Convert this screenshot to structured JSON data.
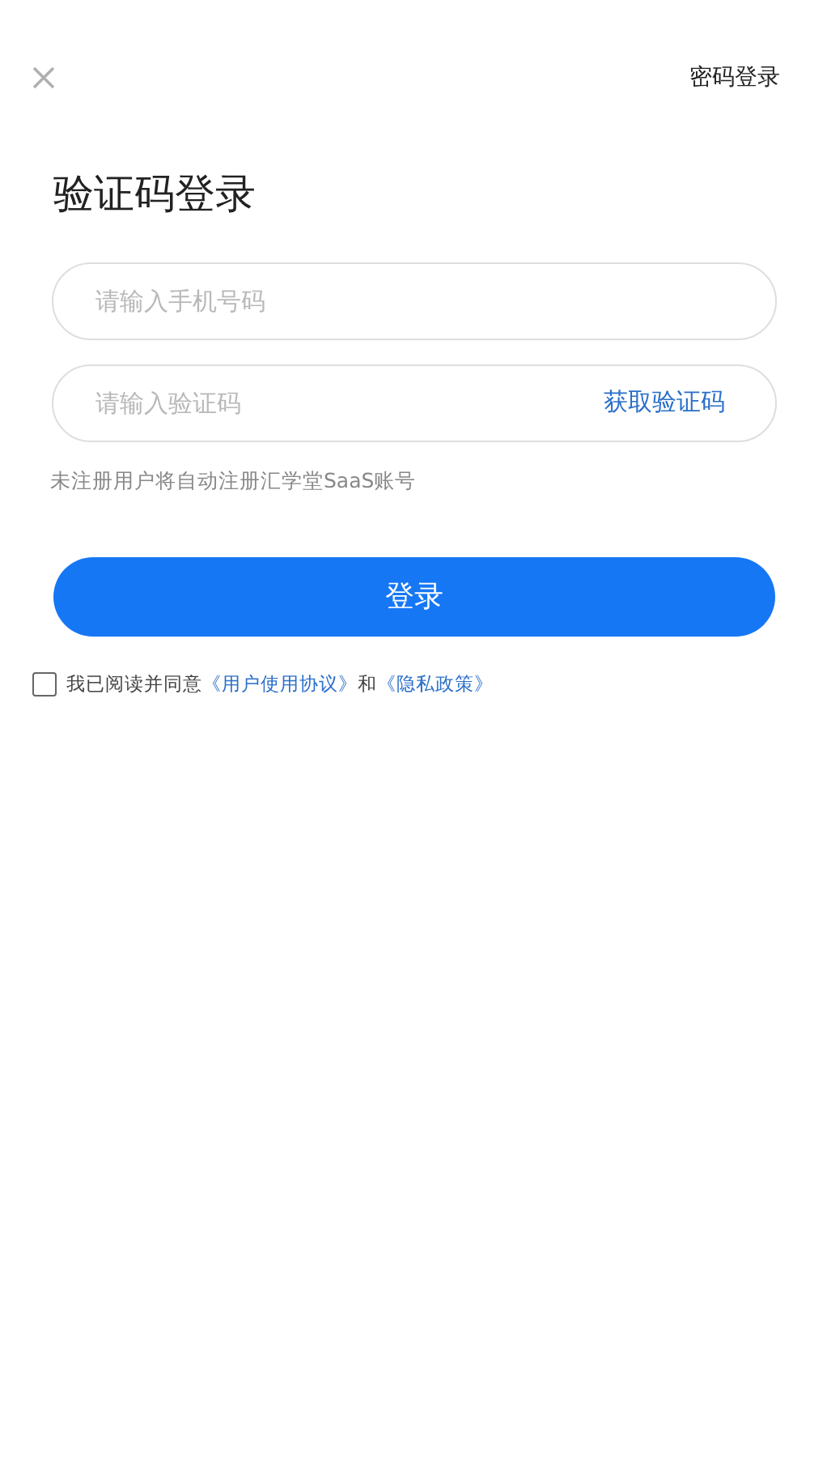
{
  "header": {
    "switch_link": "密码登录"
  },
  "title": "验证码登录",
  "phone_field": {
    "placeholder": "请输入手机号码"
  },
  "code_field": {
    "placeholder": "请输入验证码",
    "action": "获取验证码"
  },
  "hint": "未注册用户将自动注册汇学堂SaaS账号",
  "login_button": "登录",
  "agreement": {
    "checked": false,
    "text": "我已阅读并同意",
    "terms_link": "《用户使用协议》",
    "joiner": "和",
    "privacy_link": "《隐私政策》"
  }
}
